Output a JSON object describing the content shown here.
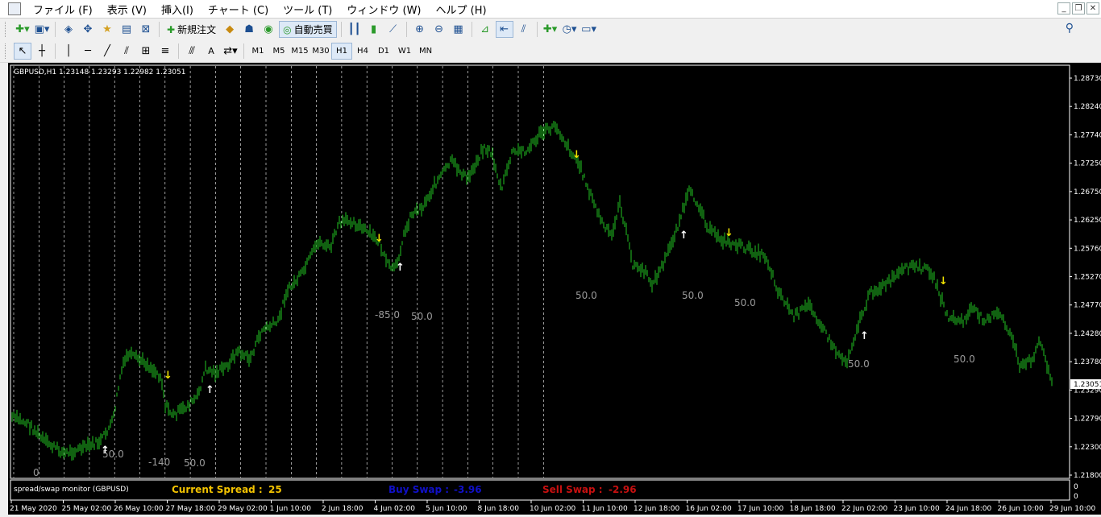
{
  "menu": [
    "ファイル (F)",
    "表示 (V)",
    "挿入(I)",
    "チャート (C)",
    "ツール (T)",
    "ウィンドウ (W)",
    "ヘルプ (H)"
  ],
  "toolbar": {
    "new_order": "新規注文",
    "auto_trading": "自動売買"
  },
  "timeframes": [
    "M1",
    "M5",
    "M15",
    "M30",
    "H1",
    "H4",
    "D1",
    "W1",
    "MN"
  ],
  "active_timeframe": "H1",
  "chart": {
    "info": "GBPUSD,H1  1.23148 1.23293 1.22982 1.23051",
    "current_price_label": "1.23051",
    "price_labels": [
      "1.28730",
      "1.28240",
      "1.27740",
      "1.27250",
      "1.26750",
      "1.26250",
      "1.25760",
      "1.25270",
      "1.24770",
      "1.24280",
      "1.23780",
      "1.23290",
      "1.22790",
      "1.22300",
      "1.21800"
    ],
    "time_labels": [
      "21 May 2020",
      "25 May 02:00",
      "26 May 10:00",
      "27 May 18:00",
      "29 May 02:00",
      "1 Jun 10:00",
      "2 Jun 18:00",
      "4 Jun 02:00",
      "5 Jun 10:00",
      "8 Jun 18:00",
      "10 Jun 02:00",
      "11 Jun 10:00",
      "12 Jun 18:00",
      "16 Jun 02:00",
      "17 Jun 10:00",
      "18 Jun 18:00",
      "22 Jun 02:00",
      "23 Jun 10:00",
      "24 Jun 18:00",
      "26 Jun 10:00",
      "29 Jun 10:00"
    ],
    "annotations": [
      "0",
      "50.0",
      "-140",
      "50.0",
      "-85.0",
      "50.0",
      "50.0",
      "50.0",
      "50.0",
      "50.0",
      "50.0"
    ],
    "colors": {
      "candle": "#22c322",
      "up_arrow": "#ffffff",
      "down_arrow": "#f2e400",
      "grid": "#ffffff",
      "background": "#000000"
    }
  },
  "indicator": {
    "name": "spread/swap monitor (GBPUSD)",
    "spread_label": "Current Spread :",
    "spread_value": "25",
    "buy_swap_label": "Buy Swap :",
    "buy_swap_value": "-3.96",
    "sell_swap_label": "Sell Swap :",
    "sell_swap_value": "-2.96",
    "scale_labels": [
      "0",
      "0"
    ],
    "colors": {
      "spread": "#f2c200",
      "buy": "#1010c8",
      "sell": "#c81010"
    }
  }
}
